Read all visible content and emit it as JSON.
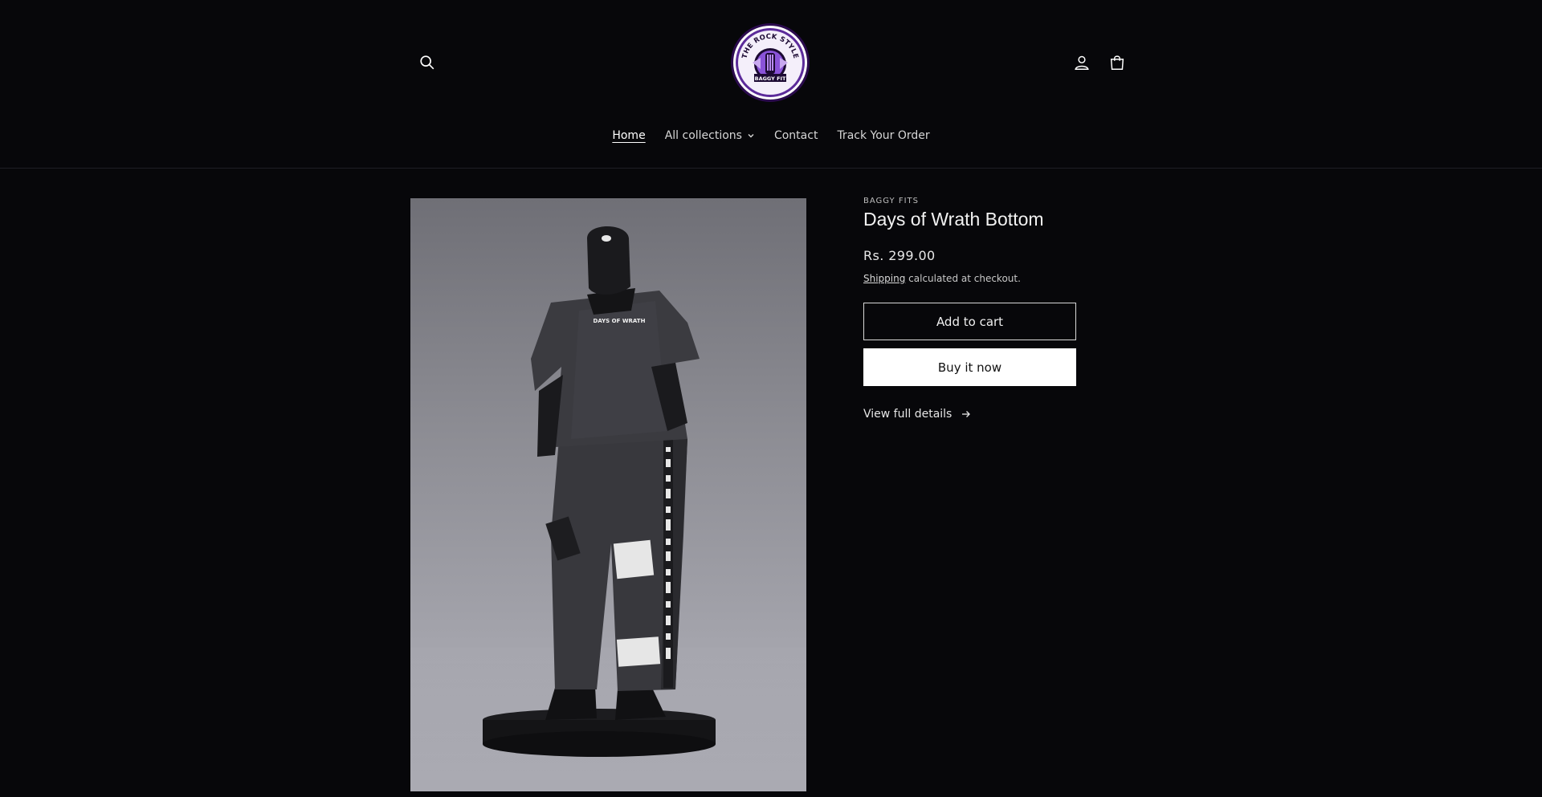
{
  "header": {
    "logo": {
      "top_text": "THE ROCK STYLE",
      "bottom_text": "BAGGY FIT"
    },
    "icons": {
      "search": "search-icon",
      "account": "account-icon",
      "cart": "cart-icon"
    },
    "nav": [
      {
        "label": "Home",
        "active": true
      },
      {
        "label": "All collections",
        "has_dropdown": true
      },
      {
        "label": "Contact"
      },
      {
        "label": "Track Your Order"
      }
    ]
  },
  "product": {
    "vendor": "BAGGY FITS",
    "title": "Days of Wrath Bottom",
    "price": "Rs. 299.00",
    "shipping_link": "Shipping",
    "shipping_note": " calculated at checkout.",
    "add_to_cart": "Add to cart",
    "buy_now": "Buy it now",
    "view_details": "View full details",
    "image_text": "DAYS OF WRATH"
  },
  "colors": {
    "background": "#07070a",
    "accent_logo": "#7b3fd1",
    "button_solid": "#ffffff"
  }
}
